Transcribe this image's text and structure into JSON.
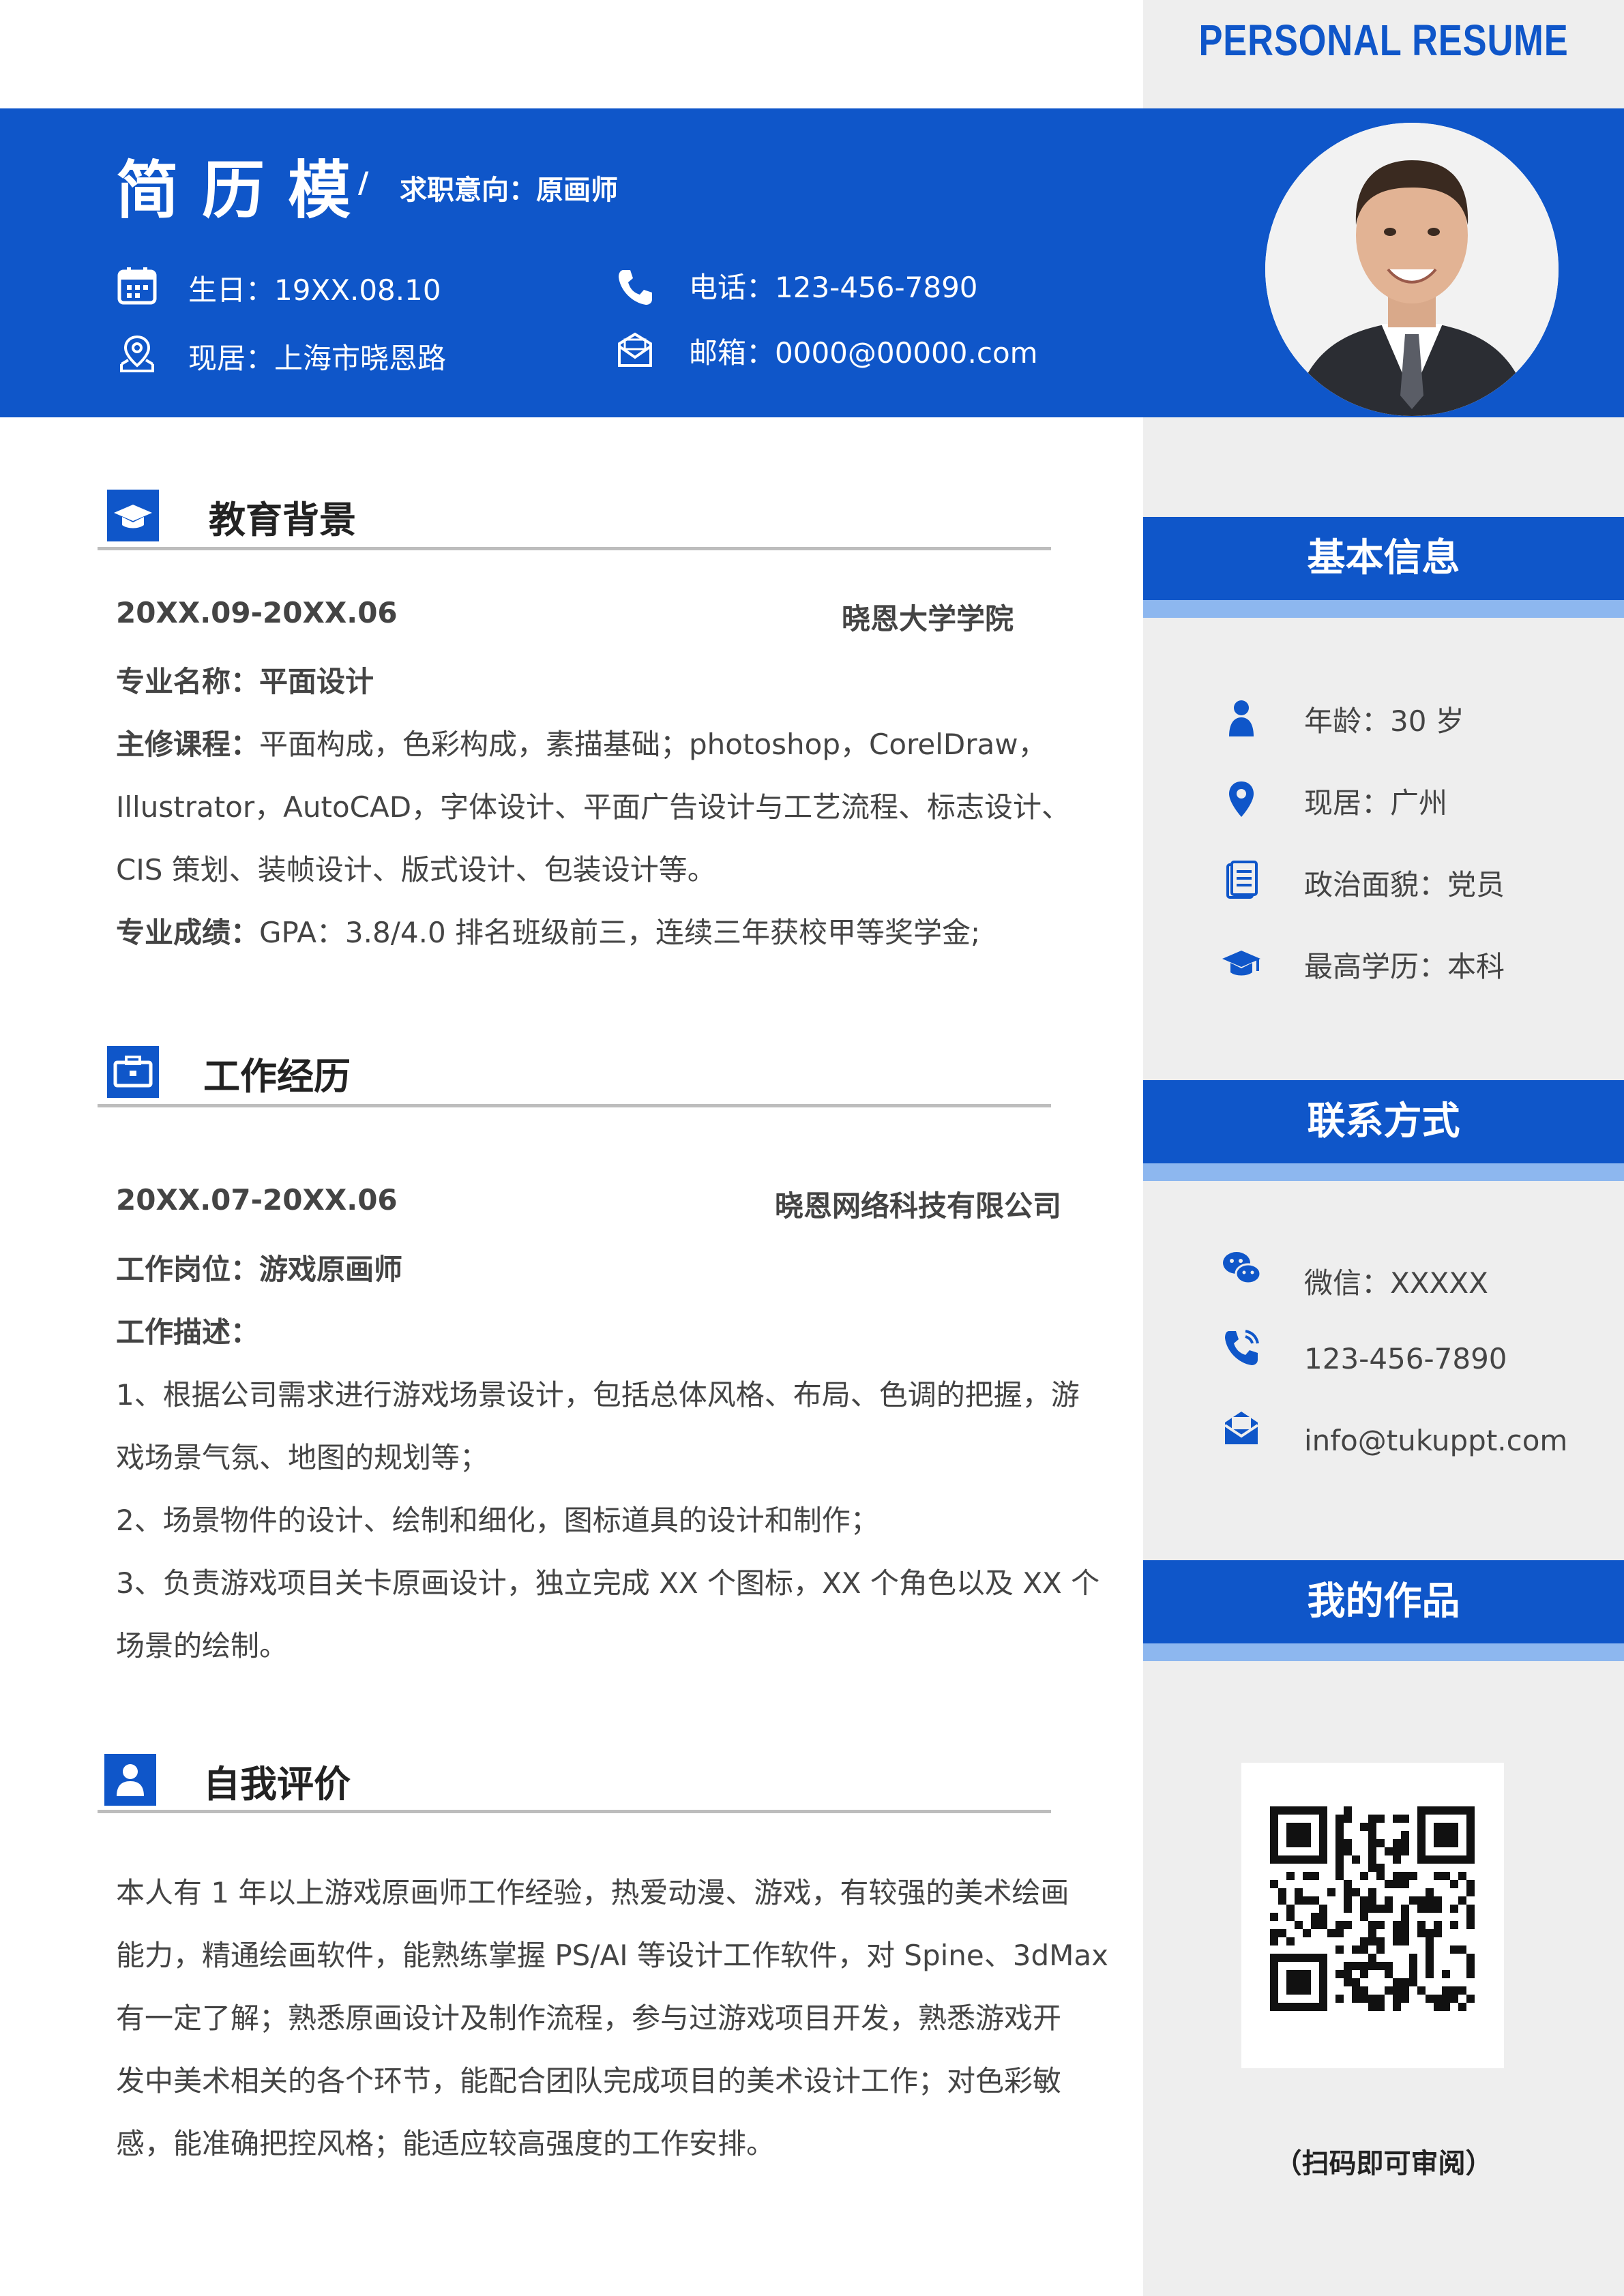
{
  "header": {
    "brand_title": "PERSONAL RESUME",
    "name": "简历模",
    "slash": "/",
    "job_intent": "求职意向：原画师",
    "birthday": "生日：19XX.08.10",
    "phone": "电话：123-456-7890",
    "residence": "现居：上海市晓恩路",
    "email": "邮箱：0000@00000.com"
  },
  "education": {
    "title": "教育背景",
    "date": "20XX.09-20XX.06",
    "school": "晓恩大学学院",
    "major_label": "专业名称：",
    "major_value": "平面设计",
    "courses_label": "主修课程：",
    "courses_line1": "平面构成，色彩构成，素描基础；photoshop，CorelDraw，",
    "courses_line2": "Illustrator，AutoCAD，字体设计、平面广告设计与工艺流程、标志设计、",
    "courses_line3": "CIS 策划、装帧设计、版式设计、包装设计等。",
    "score_label": "专业成绩：",
    "score_value": "GPA：3.8/4.0   排名班级前三，连续三年获校甲等奖学金;"
  },
  "work": {
    "title": "工作经历",
    "date": "20XX.07-20XX.06",
    "company": "晓恩网络科技有限公司",
    "position_label": "工作岗位：",
    "position_value": "游戏原画师",
    "desc_label": "工作描述：",
    "desc_lines": [
      "1、根据公司需求进行游戏场景设计，包括总体风格、布局、色调的把握，游",
      "戏场景气氛、地图的规划等；",
      "2、场景物件的设计、绘制和细化，图标道具的设计和制作；",
      "3、负责游戏项目关卡原画设计，独立完成 XX 个图标，XX 个角色以及 XX 个",
      "场景的绘制。"
    ]
  },
  "self": {
    "title": "自我评价",
    "lines": [
      "本人有 1 年以上游戏原画师工作经验，热爱动漫、游戏，有较强的美术绘画",
      "能力，精通绘画软件，能熟练掌握 PS/AI 等设计工作软件，对 Spine、3dMax",
      "有一定了解；熟悉原画设计及制作流程，参与过游戏项目开发，熟悉游戏开",
      "发中美术相关的各个环节，能配合团队完成项目的美术设计工作；对色彩敏",
      "感，能准确把控风格；能适应较高强度的工作安排。"
    ]
  },
  "sidebar": {
    "basic_title": "基本信息",
    "age": "年龄：30 岁",
    "residence": "现居：广州",
    "politics": "政治面貌：党员",
    "degree": "最高学历：本科",
    "contact_title": "联系方式",
    "wechat": "微信：XXXXX",
    "phone": "123-456-7890",
    "email": "info@tukuppt.com",
    "works_title": "我的作品",
    "qr_caption": "（扫码即可审阅）"
  },
  "colors": {
    "primary": "#0f56c9",
    "light_accent": "#8db7ef",
    "sidebar_bg": "#eeeeee"
  }
}
